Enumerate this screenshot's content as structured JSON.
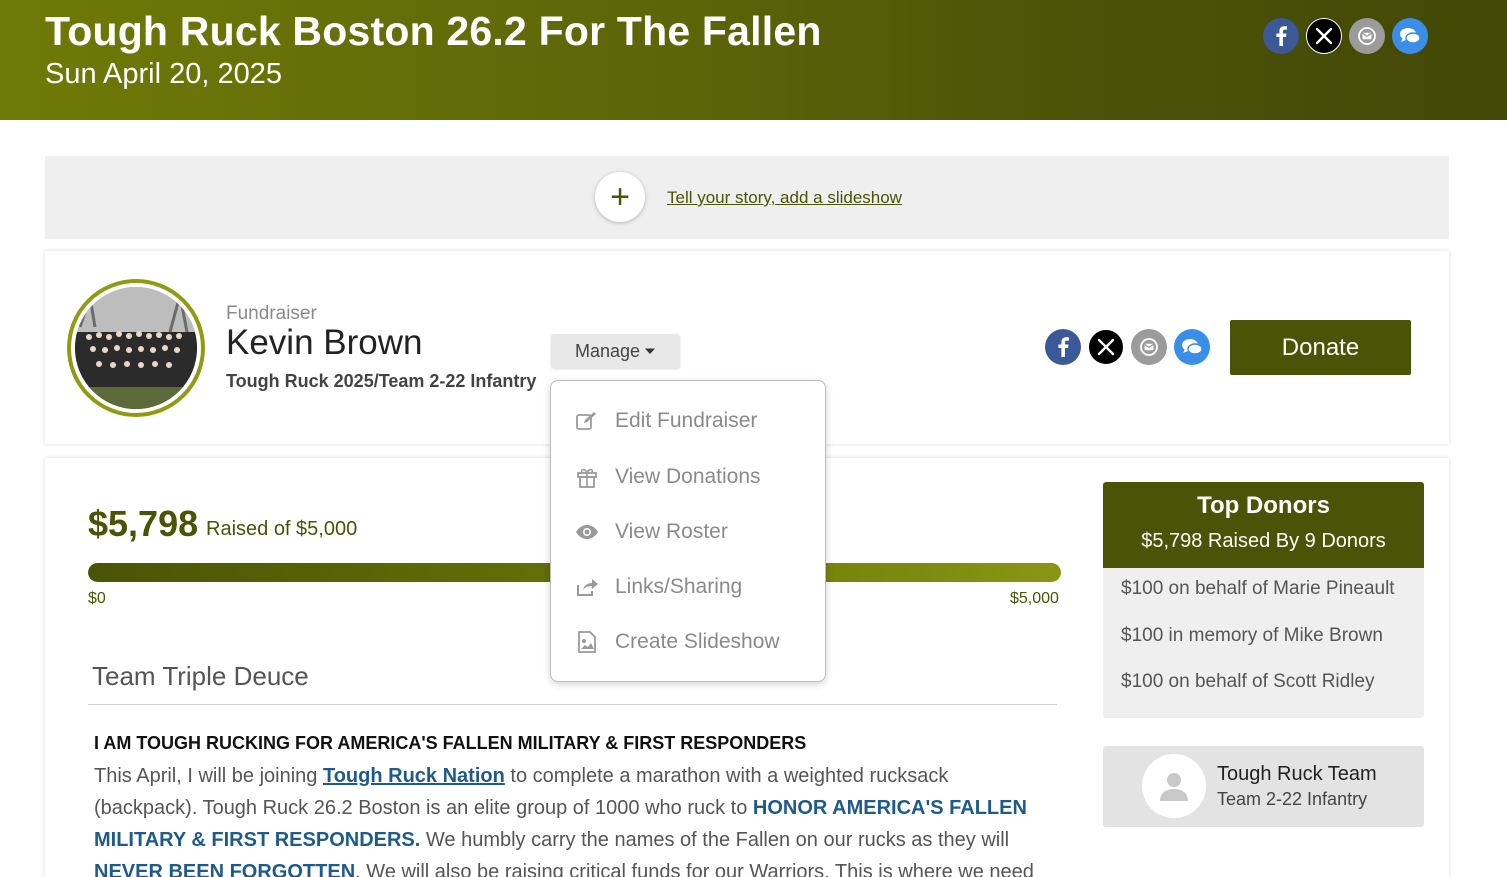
{
  "header": {
    "title": "Tough Ruck Boston 26.2 For The Fallen",
    "date": "Sun April 20, 2025"
  },
  "story_bar": {
    "plus": "+",
    "link": "Tell your story, add a slideshow"
  },
  "fundraiser": {
    "label": "Fundraiser",
    "name": "Kevin Brown",
    "team": "Tough Ruck 2025/Team 2-22 Infantry",
    "manage_label": "Manage",
    "donate_label": "Donate"
  },
  "manage_menu": [
    {
      "label": "Edit Fundraiser",
      "icon": "edit-icon"
    },
    {
      "label": "View Donations",
      "icon": "gift-icon"
    },
    {
      "label": "View Roster",
      "icon": "eye-icon"
    },
    {
      "label": "Links/Sharing",
      "icon": "share-icon"
    },
    {
      "label": "Create Slideshow",
      "icon": "image-icon"
    }
  ],
  "progress": {
    "raised": "$5,798",
    "raised_of": "Raised of $5,000",
    "min_label": "$0",
    "max_label": "$5,000",
    "percent": 100
  },
  "content": {
    "team_heading": "Team Triple Deuce",
    "story_heading": "I AM TOUGH RUCKING FOR AMERICA'S FALLEN MILITARY & FIRST RESPONDERS",
    "p1_a": "This April, I will be joining ",
    "p1_link": "Tough Ruck Nation",
    "p1_b": " to complete a marathon with a weighted rucksack (backpack). Tough Ruck 26.2 Boston is an elite group of 1000 who ruck to ",
    "p1_hl1": "HONOR AMERICA'S FALLEN MILITARY & FIRST RESPONDERS.",
    "p1_c": " We humbly carry the names of the Fallen on our rucks as they will ",
    "p1_hl2": "NEVER BEEN FORGOTTEN",
    "p1_d": ". We will also be raising critical funds for our Warriors. This is where we need"
  },
  "top_donors": {
    "title": "Top Donors",
    "subtitle": "$5,798 Raised By 9 Donors",
    "rows": [
      "$100 on behalf of Marie Pineault",
      "$100 in memory of Mike Brown",
      "$100 on behalf of Scott Ridley"
    ]
  },
  "team_card": {
    "name": "Tough Ruck Team",
    "sub": "Team 2-22 Infantry"
  },
  "colors": {
    "brand": "#4a5406",
    "link": "#1f5a8c"
  },
  "icons": {
    "social": [
      "facebook-icon",
      "x-icon",
      "email-icon",
      "messenger-icon"
    ]
  }
}
